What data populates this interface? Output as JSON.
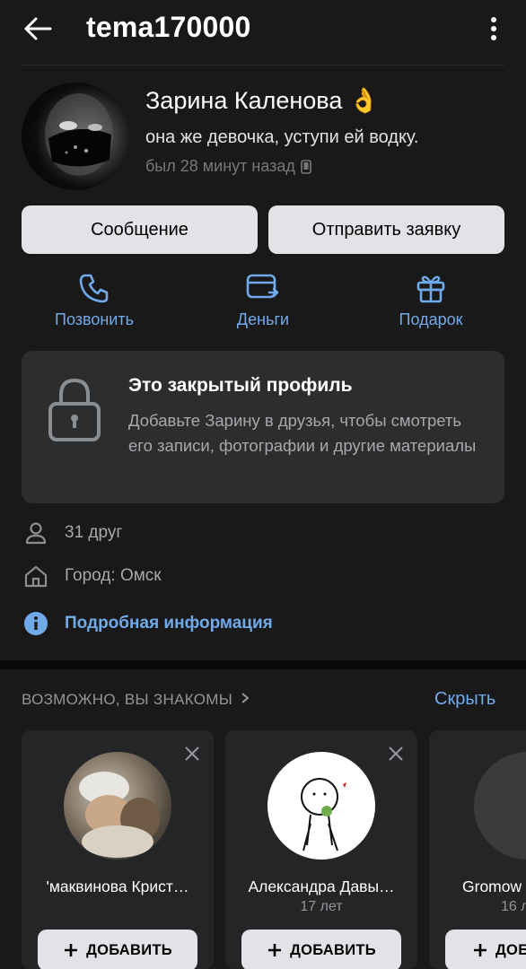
{
  "header": {
    "title": "tema170000"
  },
  "profile": {
    "name": "Зарина Каленова",
    "name_emoji": "👌",
    "status": "она же девочка, уступи ей водку.",
    "last_seen": "был 28 минут назад"
  },
  "buttons": {
    "message": "Сообщение",
    "request": "Отправить заявку"
  },
  "actions": {
    "call": "Позвонить",
    "money": "Деньги",
    "gift": "Подарок"
  },
  "closed_profile": {
    "title": "Это закрытый профиль",
    "description": "Добавьте Зарину в друзья, чтобы смотреть его записи, фотографии и другие материалы"
  },
  "info": {
    "friends": "31 друг",
    "city": "Город: Омск",
    "details": "Подробная информация"
  },
  "suggestions": {
    "header": "ВОЗМОЖНО, ВЫ ЗНАКОМЫ",
    "hide": "Скрыть",
    "add_label": "ДОБАВИТЬ",
    "cards": [
      {
        "name": "'маквинова Крист…",
        "age": ""
      },
      {
        "name": "Александра Давы…",
        "age": "17 лет"
      },
      {
        "name": "Gromow",
        "age": "16 л"
      }
    ]
  },
  "colors": {
    "background": "#19191a",
    "card": "#2c2d2e",
    "accent": "#71aaeb",
    "button": "#e1e3e6"
  }
}
